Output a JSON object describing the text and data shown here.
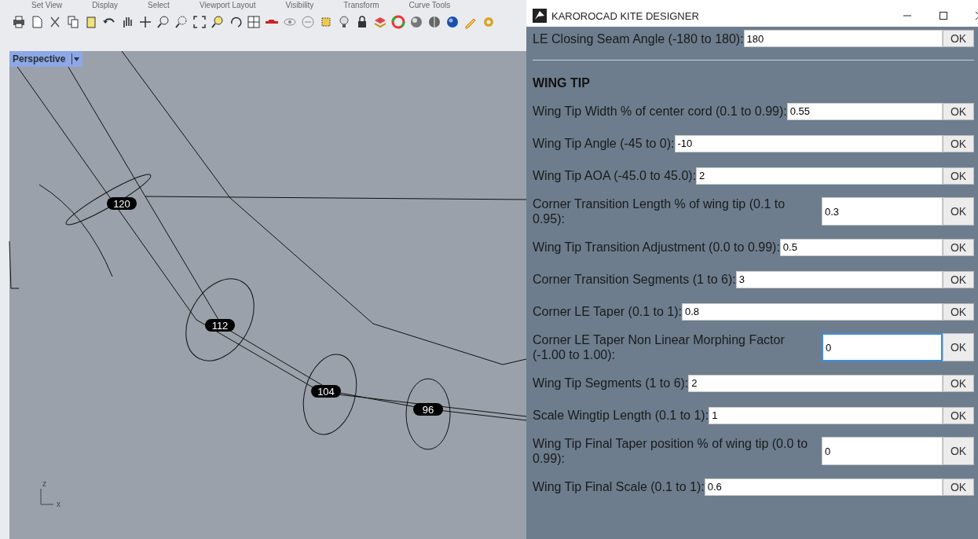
{
  "ribbon_tabs": [
    "Set View",
    "Display",
    "Select",
    "Viewport Layout",
    "Visibility",
    "Transform",
    "Curve Tools"
  ],
  "viewport": {
    "label": "Perspective",
    "point_labels": [
      "120",
      "112",
      "104",
      "96"
    ],
    "axis_labels": [
      "z",
      "x"
    ]
  },
  "dialog": {
    "title": "KAROROCAD KITE DESIGNER",
    "top_field": {
      "label": "LE Closing Seam Angle (-180 to 180):",
      "value": "180",
      "focused": false,
      "button": "OK"
    },
    "section": "WING TIP",
    "fields": [
      {
        "label": "Wing Tip Width % of center cord (0.1 to 0.99):",
        "value": "0.55",
        "kind": "inline",
        "focused": false,
        "button": "OK"
      },
      {
        "label": "Wing Tip Angle (-45 to 0):",
        "value": "-10",
        "kind": "inline",
        "focused": false,
        "button": "OK"
      },
      {
        "label": "Wing Tip AOA (-45.0 to 45.0):",
        "value": "2",
        "kind": "inline",
        "focused": false,
        "button": "OK"
      },
      {
        "label": "Corner Transition Length % of wing tip (0.1 to 0.95):",
        "value": "0.3",
        "kind": "wrapped",
        "focused": false,
        "button": "OK"
      },
      {
        "label": "Wing Tip Transition Adjustment (0.0 to 0.99):",
        "value": "0.5",
        "kind": "inline",
        "focused": false,
        "button": "OK"
      },
      {
        "label": "Corner Transition Segments (1 to 6):",
        "value": "3",
        "kind": "inline",
        "focused": false,
        "button": "OK"
      },
      {
        "label": "Corner LE Taper (0.1 to 1):",
        "value": "0.8",
        "kind": "inline",
        "focused": false,
        "button": "OK"
      },
      {
        "label": "Corner LE Taper Non Linear Morphing Factor (-1.00 to 1.00):",
        "value": "0",
        "kind": "wrapped",
        "focused": true,
        "button": "OK"
      },
      {
        "label": "Wing Tip Segments (1 to 6):",
        "value": "2",
        "kind": "inline",
        "focused": false,
        "button": "OK"
      },
      {
        "label": "Scale Wingtip Length (0.1 to 1):",
        "value": "1",
        "kind": "inline",
        "focused": false,
        "button": "OK"
      },
      {
        "label": "Wing Tip Final Taper position % of wing tip (0.0 to 0.99):",
        "value": "0",
        "kind": "wrapped",
        "focused": false,
        "button": "OK"
      },
      {
        "label": "Wing Tip Final Scale (0.1 to 1):",
        "value": "0.6",
        "kind": "inline",
        "focused": false,
        "button": "OK"
      }
    ]
  }
}
